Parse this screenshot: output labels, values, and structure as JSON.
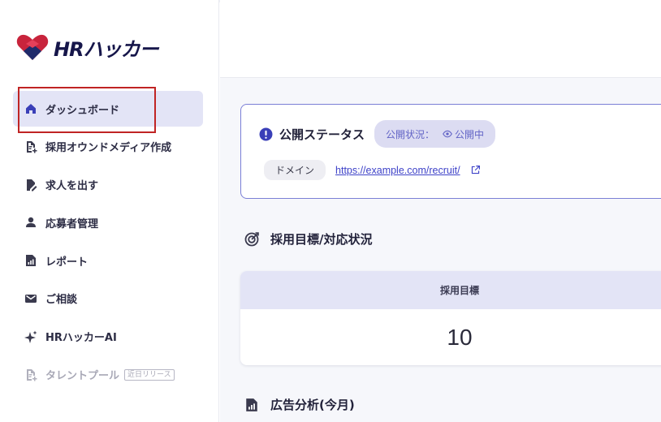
{
  "brand": {
    "logo_text": "HRハッカー"
  },
  "sidebar": {
    "items": [
      {
        "label": "ダッシュボード",
        "icon": "home-icon"
      },
      {
        "label": "採用オウンドメディア作成",
        "icon": "document-add-icon"
      },
      {
        "label": "求人を出す",
        "icon": "document-edit-icon"
      },
      {
        "label": "応募者管理",
        "icon": "person-icon"
      },
      {
        "label": "レポート",
        "icon": "report-chart-icon"
      },
      {
        "label": "ご相談",
        "icon": "mail-icon"
      },
      {
        "label": "HRハッカーAI",
        "icon": "sparkle-icon"
      },
      {
        "label": "タレントプール",
        "icon": "document-add-icon",
        "badge": "近日リリース"
      }
    ]
  },
  "status": {
    "title": "公開ステータス",
    "pill_label": "公開状況：",
    "pill_value": "公開中",
    "domain_label": "ドメイン",
    "domain_url": "https://example.com/recruit/"
  },
  "sections": {
    "goals_title": "採用目標/対応状況",
    "ads_title": "広告分析(今月)"
  },
  "goal": {
    "header": "採用目標",
    "value": "10"
  },
  "colors": {
    "accent": "#6264c6",
    "active_bg": "#e3e4f6",
    "highlight": "#c02424",
    "link": "#3e42c8"
  }
}
